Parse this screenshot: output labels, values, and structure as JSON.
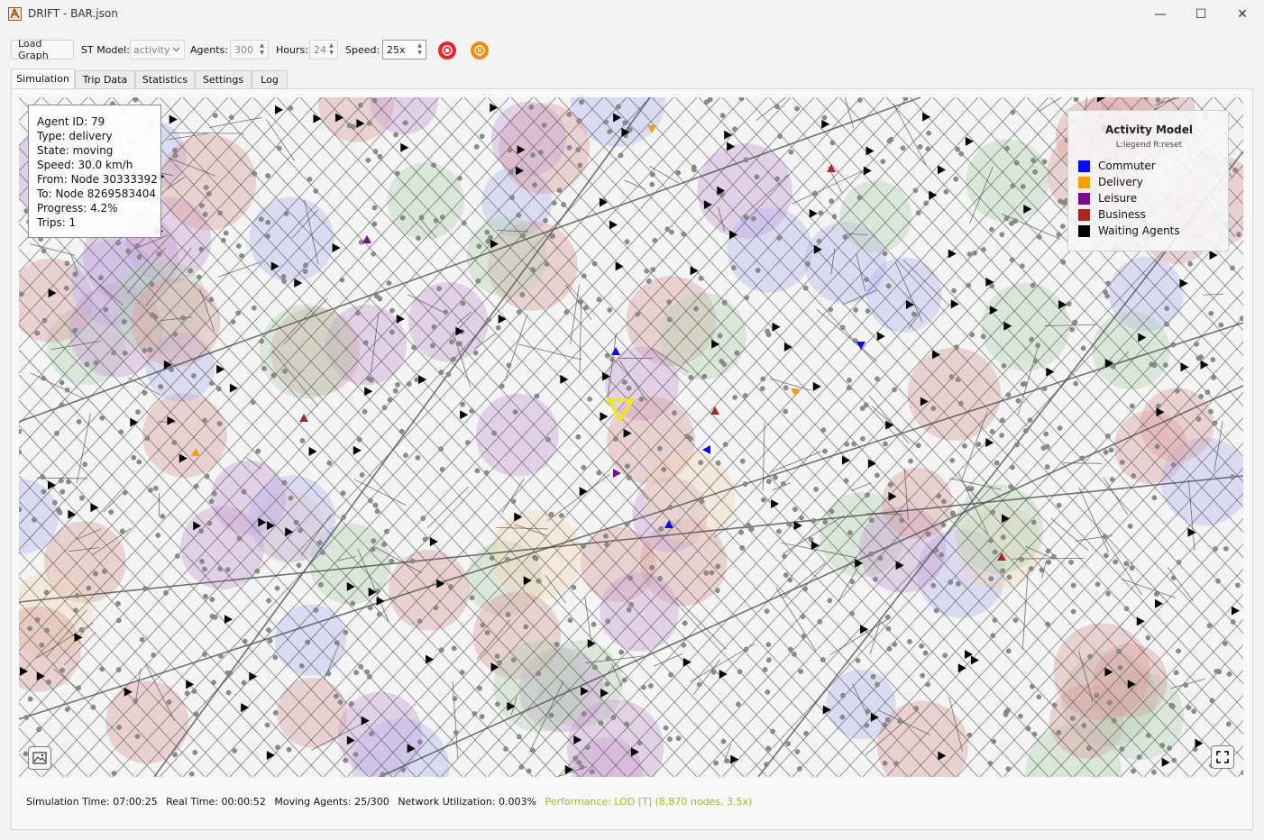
{
  "window": {
    "title": "DRIFT - BAR.json",
    "controls": {
      "minimize": "—",
      "maximize": "☐",
      "close": "✕"
    }
  },
  "toolbar": {
    "load_graph": "Load Graph",
    "st_model_label": "ST Model:",
    "st_model_value": "activity",
    "agents_label": "Agents:",
    "agents_value": "300",
    "hours_label": "Hours:",
    "hours_value": "24",
    "speed_label": "Speed:",
    "speed_value": "25x",
    "stop_color": "#e8252b",
    "pause_color": "#f28c0f"
  },
  "tabs": [
    {
      "label": "Simulation",
      "active": true
    },
    {
      "label": "Trip Data",
      "active": false
    },
    {
      "label": "Statistics",
      "active": false
    },
    {
      "label": "Settings",
      "active": false
    },
    {
      "label": "Log",
      "active": false
    }
  ],
  "agent_info": {
    "lines": [
      "Agent ID: 79",
      "Type: delivery",
      "State: moving",
      "Speed: 30.0 km/h",
      "From: Node 30333392",
      "To: Node 8269583404",
      "Progress: 4.2%",
      "Trips: 1"
    ]
  },
  "legend": {
    "title": "Activity Model",
    "subtitle": "L:legend R:reset",
    "items": [
      {
        "label": "Commuter",
        "color": "#0a0af2"
      },
      {
        "label": "Delivery",
        "color": "#f5a00a"
      },
      {
        "label": "Leisure",
        "color": "#7d0a8c"
      },
      {
        "label": "Business",
        "color": "#a82828"
      },
      {
        "label": "Waiting Agents",
        "color": "#000000"
      }
    ]
  },
  "map_buttons": {
    "image_icon": "image-icon",
    "fullscreen_icon": "fullscreen-icon"
  },
  "status": {
    "sim_time": "Simulation Time: 07:00:25",
    "real_time": "Real Time: 00:00:52",
    "moving_agents": "Moving Agents: 25/300",
    "network_util": "Network Utilization: 0.003%",
    "performance": "Performance: LOD [T] (8,870 nodes, 3.5x)"
  },
  "colors": {
    "zone_commuter": "#b4b4f0",
    "zone_leisure": "#c8a0d2",
    "zone_business": "#dca0a0",
    "zone_green": "#b4d2b4",
    "zone_delivery": "#f0d7b4",
    "road": "#505050",
    "node": "#8c8c8c",
    "selected_agent": "#f0e61e",
    "performance_text": "#8fc21b"
  }
}
